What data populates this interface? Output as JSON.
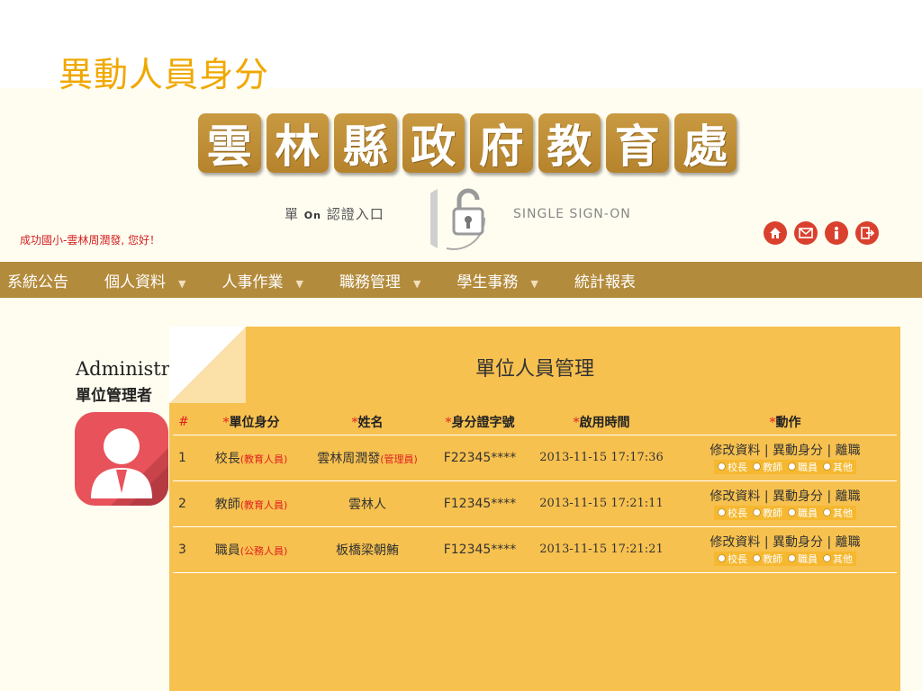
{
  "slide_title": "異動人員身分",
  "banner": {
    "chars": [
      "雲",
      "林",
      "縣",
      "政",
      "府",
      "教",
      "育",
      "處"
    ]
  },
  "sso": {
    "label_pre": "單",
    "label_key": "On",
    "label_post": "認證入口",
    "english": "SINGLE SIGN-ON"
  },
  "welcome": "成功國小-雲林周潤發, 您好！",
  "top_icons": [
    "home-icon",
    "mail-icon",
    "info-icon",
    "logout-icon"
  ],
  "nav": [
    {
      "label": "系統公告",
      "dropdown": false
    },
    {
      "label": "個人資料",
      "dropdown": true
    },
    {
      "label": "人事作業",
      "dropdown": true
    },
    {
      "label": "職務管理",
      "dropdown": true
    },
    {
      "label": "學生事務",
      "dropdown": true
    },
    {
      "label": "統計報表",
      "dropdown": false
    }
  ],
  "user": {
    "name": "Administrator",
    "role": "單位管理者"
  },
  "panel": {
    "title": "單位人員管理",
    "columns": [
      "#",
      "單位身分",
      "姓名",
      "身分證字號",
      "啟用時間",
      "動作"
    ],
    "rows": [
      {
        "idx": "1",
        "role": "校長",
        "role_tag": "(教育人員)",
        "name": "雲林周潤發",
        "name_tag": "(管理員)",
        "id": "F22345****",
        "time": "2013-11-15 17:17:36"
      },
      {
        "idx": "2",
        "role": "教師",
        "role_tag": "(教育人員)",
        "name": "雲林人",
        "name_tag": "",
        "id": "F12345****",
        "time": "2013-11-15 17:21:11"
      },
      {
        "idx": "3",
        "role": "職員",
        "role_tag": "(公務人員)",
        "name": "板橋梁朝鮪",
        "name_tag": "",
        "id": "F12345****",
        "time": "2013-11-15 17:21:21"
      }
    ],
    "action_links": [
      "修改資料",
      "異動身分",
      "離職"
    ],
    "radio_options": [
      "校長",
      "教師",
      "職員",
      "其他"
    ]
  },
  "colors": {
    "nav": "#b38b3c",
    "panel": "#f7c14f",
    "accent_red": "#e02020",
    "title": "#f0a800"
  }
}
